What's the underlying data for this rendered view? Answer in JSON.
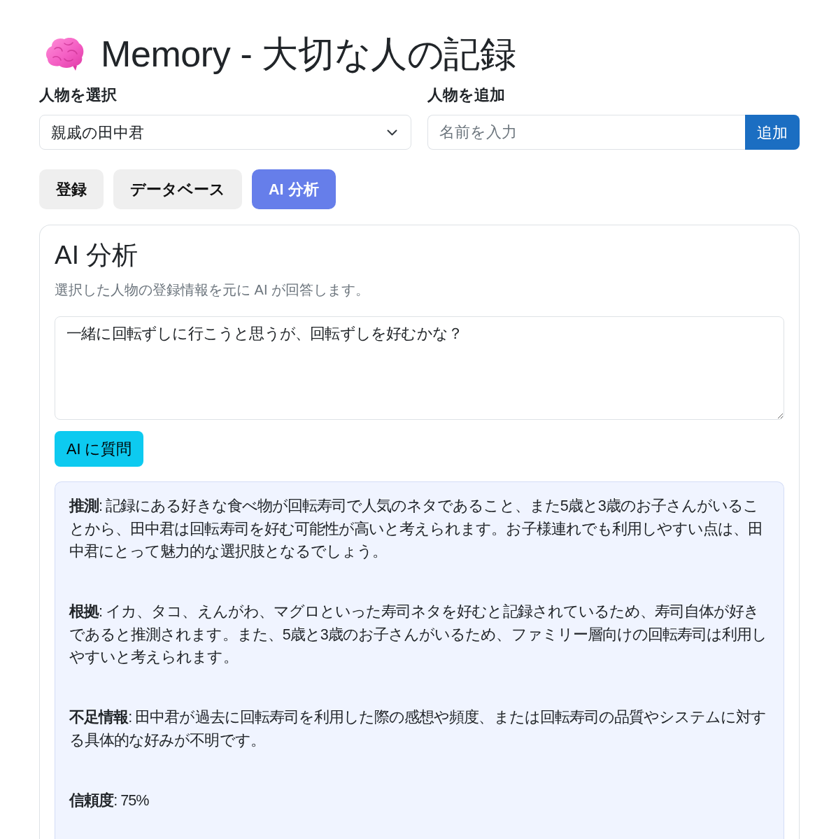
{
  "header": {
    "title": "Memory - 大切な人の記録"
  },
  "person_select": {
    "label": "人物を選択",
    "value": "親戚の田中君"
  },
  "add_person": {
    "label": "人物を追加",
    "placeholder": "名前を入力",
    "button": "追加"
  },
  "tabs": [
    {
      "label": "登録",
      "selected": false
    },
    {
      "label": "データベース",
      "selected": false
    },
    {
      "label": "AI 分析",
      "selected": true
    }
  ],
  "panel": {
    "title": "AI 分析",
    "description": "選択した人物の登録情報を元に AI が回答します。",
    "question": {
      "value": "一緒に回転ずしに行こうと思うが、回転ずしを好むかな？"
    },
    "ask_button": "AI に質問",
    "answer": [
      "**推測**: 記録にある好きな食べ物が回転寿司で人気のネタであること、また5歳と3歳のお子さんがいることから、田中君は回転寿司を好む可能性が高いと考えられます。お子様連れでも利用しやすい点は、田中君にとって魅力的な選択肢となるでしょう。",
      "**根拠**: イカ、タコ、えんがわ、マグロといった寿司ネタを好むと記録されているため、寿司自体が好きであると推測されます。また、5歳と3歳のお子さんがいるため、ファミリー層向けの回転寿司は利用しやすいと考えられます。",
      "**不足情報**: 田中君が過去に回転寿司を利用した際の感想や頻度、または回転寿司の品質やシステムに対する具体的な好みが不明です。",
      "**信頼度**: 75%"
    ]
  }
}
